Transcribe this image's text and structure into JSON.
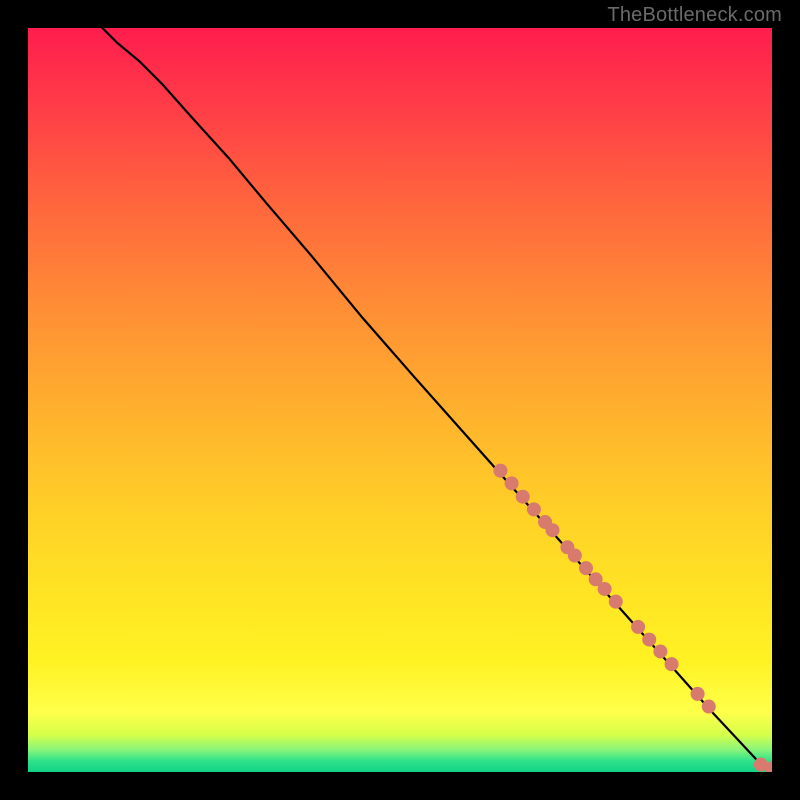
{
  "watermark": "TheBottleneck.com",
  "chart_data": {
    "type": "line",
    "title": "",
    "xlabel": "",
    "ylabel": "",
    "xlim": [
      0,
      100
    ],
    "ylim": [
      0,
      100
    ],
    "grid": false,
    "legend": false,
    "curve": [
      {
        "x": 10,
        "y": 100
      },
      {
        "x": 12,
        "y": 98
      },
      {
        "x": 15,
        "y": 95.5
      },
      {
        "x": 18,
        "y": 92.5
      },
      {
        "x": 22,
        "y": 88
      },
      {
        "x": 27,
        "y": 82.5
      },
      {
        "x": 32,
        "y": 76.5
      },
      {
        "x": 38,
        "y": 69.5
      },
      {
        "x": 45,
        "y": 61
      },
      {
        "x": 52,
        "y": 53
      },
      {
        "x": 60,
        "y": 44
      },
      {
        "x": 68,
        "y": 35
      },
      {
        "x": 76,
        "y": 26
      },
      {
        "x": 84,
        "y": 17
      },
      {
        "x": 92,
        "y": 8
      },
      {
        "x": 99,
        "y": 0.5
      }
    ],
    "points": [
      {
        "x": 63.5,
        "y": 40.5
      },
      {
        "x": 65.0,
        "y": 38.8
      },
      {
        "x": 66.5,
        "y": 37.0
      },
      {
        "x": 68.0,
        "y": 35.3
      },
      {
        "x": 69.5,
        "y": 33.6
      },
      {
        "x": 70.5,
        "y": 32.5
      },
      {
        "x": 72.5,
        "y": 30.2
      },
      {
        "x": 73.5,
        "y": 29.1
      },
      {
        "x": 75.0,
        "y": 27.4
      },
      {
        "x": 76.3,
        "y": 25.9
      },
      {
        "x": 77.5,
        "y": 24.6
      },
      {
        "x": 79.0,
        "y": 22.9
      },
      {
        "x": 82.0,
        "y": 19.5
      },
      {
        "x": 83.5,
        "y": 17.8
      },
      {
        "x": 85.0,
        "y": 16.2
      },
      {
        "x": 86.5,
        "y": 14.5
      },
      {
        "x": 90.0,
        "y": 10.5
      },
      {
        "x": 91.5,
        "y": 8.8
      },
      {
        "x": 98.5,
        "y": 1.0
      },
      {
        "x": 100.0,
        "y": 0.5
      }
    ],
    "dot_radius_px": 7,
    "colors": {
      "dot": "#d87a6e",
      "curve": "#000000",
      "gradient_stops": [
        "#ff1d4d",
        "#ff8f35",
        "#ffe224",
        "#ffff4a",
        "#2fe28a"
      ]
    }
  }
}
